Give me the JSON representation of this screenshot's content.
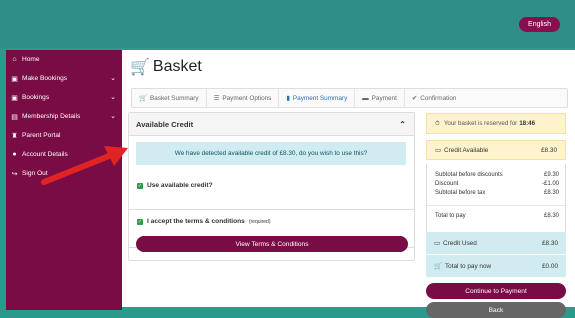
{
  "header": {
    "language_button": "English"
  },
  "sidebar": {
    "items": [
      {
        "label": "Home",
        "icon": "home-icon",
        "glyph": "⌂",
        "has_chevron": false
      },
      {
        "label": "Make Bookings",
        "icon": "calendar-icon",
        "glyph": "▣",
        "has_chevron": true
      },
      {
        "label": "Bookings",
        "icon": "calendar-icon",
        "glyph": "▣",
        "has_chevron": true
      },
      {
        "label": "Membership Details",
        "icon": "card-icon",
        "glyph": "▤",
        "has_chevron": true
      },
      {
        "label": "Parent Portal",
        "icon": "trophy-icon",
        "glyph": "♜",
        "has_chevron": false
      },
      {
        "label": "Account Details",
        "icon": "user-icon",
        "glyph": "●",
        "has_chevron": false
      },
      {
        "label": "Sign Out",
        "icon": "sign-out-icon",
        "glyph": "↪",
        "has_chevron": false
      }
    ]
  },
  "page": {
    "title": "Basket"
  },
  "steps": [
    {
      "label": "Basket Summary",
      "glyph": "🛒",
      "icon": "cart-icon"
    },
    {
      "label": "Payment Options",
      "glyph": "☰",
      "icon": "list-icon"
    },
    {
      "label": "Payment Summary",
      "glyph": "▮",
      "icon": "document-icon"
    },
    {
      "label": "Payment",
      "glyph": "▬",
      "icon": "card-icon"
    },
    {
      "label": "Confirmation",
      "glyph": "✔",
      "icon": "check-icon"
    }
  ],
  "credit_panel": {
    "heading": "Available Credit",
    "info_text": "We have detected available credit of £8.30, do you wish to use this?",
    "use_credit_label": "Use available credit?"
  },
  "terms": {
    "label": "I accept the terms & conditions",
    "required": "(required)",
    "button": "View Terms & Conditions"
  },
  "summary": {
    "reserved_text": "Your basket is reserved for",
    "reserved_time": "18:46",
    "credit_available_label": "Credit Available",
    "credit_available_value": "£8.30",
    "subtotal_before_discounts_label": "Subtotal before discounts",
    "subtotal_before_discounts_value": "£9.30",
    "discount_label": "Discount",
    "discount_value": "-£1.00",
    "subtotal_before_tax_label": "Subtotal before tax",
    "subtotal_before_tax_value": "£8.30",
    "total_to_pay_label": "Total to pay",
    "total_to_pay_value": "£8.30",
    "credit_used_label": "Credit Used",
    "credit_used_value": "£8.30",
    "total_to_pay_now_label": "Total to pay now",
    "total_to_pay_now_value": "£0.00",
    "continue_button": "Continue to Payment",
    "back_button": "Back"
  },
  "colors": {
    "brand": "#7a0c45",
    "teal": "#2f8f86",
    "info_bg": "#d1ecf1",
    "warn_bg": "#fff3cd",
    "arrow": "#e02424"
  }
}
